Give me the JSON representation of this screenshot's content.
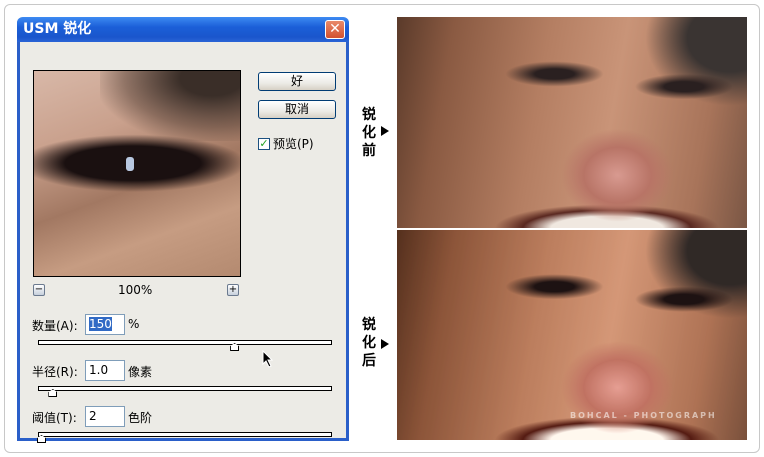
{
  "dialog": {
    "title": "USM 锐化",
    "ok_label": "好",
    "cancel_label": "取消",
    "preview_label": "预览(P)",
    "preview_checked": true,
    "zoom_out": "−",
    "zoom_in": "+",
    "zoom_level": "100%",
    "amount": {
      "label": "数量(A):",
      "value": "150",
      "unit": "%",
      "slider_fraction": 0.68
    },
    "radius": {
      "label": "半径(R):",
      "value": "1.0",
      "unit": "像素",
      "slider_fraction": 0.04
    },
    "threshold": {
      "label": "阈值(T):",
      "value": "2",
      "unit": "色阶",
      "slider_fraction": 0.0
    }
  },
  "comparison": {
    "before_label": [
      "锐",
      "化",
      "前"
    ],
    "after_label": [
      "锐",
      "化",
      "后"
    ],
    "watermark": "BOHCAL - PHOTOGRAPH"
  }
}
